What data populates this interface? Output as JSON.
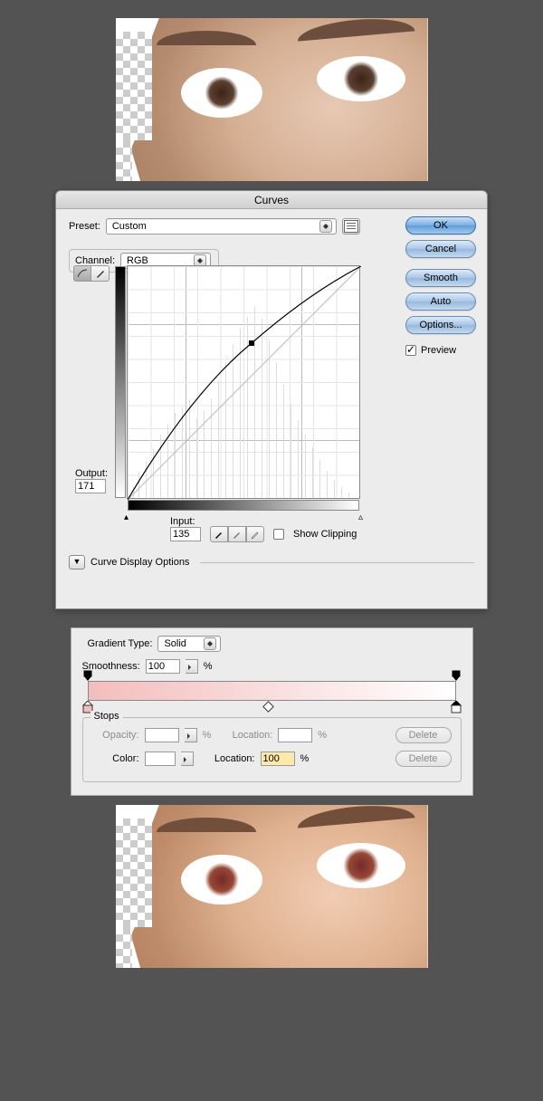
{
  "curves": {
    "title": "Curves",
    "preset_label": "Preset:",
    "preset_value": "Custom",
    "channel_label": "Channel:",
    "channel_value": "RGB",
    "output_label": "Output:",
    "output_value": "171",
    "input_label": "Input:",
    "input_value": "135",
    "show_clipping": "Show Clipping",
    "curve_display": "Curve Display Options",
    "buttons": {
      "ok": "OK",
      "cancel": "Cancel",
      "smooth": "Smooth",
      "auto": "Auto",
      "options": "Options..."
    },
    "preview": "Preview"
  },
  "chart_data": {
    "type": "line",
    "title": "Curves",
    "xlabel": "Input",
    "ylabel": "Output",
    "xlim": [
      0,
      255
    ],
    "ylim": [
      0,
      255
    ],
    "points": [
      {
        "input": 0,
        "output": 0
      },
      {
        "input": 135,
        "output": 171
      },
      {
        "input": 255,
        "output": 255
      }
    ],
    "baseline": [
      {
        "input": 0,
        "output": 0
      },
      {
        "input": 255,
        "output": 255
      }
    ]
  },
  "gradient": {
    "type_label": "Gradient Type:",
    "type_value": "Solid",
    "smoothness_label": "Smoothness:",
    "smoothness_value": "100",
    "pct": "%",
    "stops_legend": "Stops",
    "opacity_label": "Opacity:",
    "opacity_value": "",
    "opacity_location": "",
    "location_label": "Location:",
    "color_label": "Color:",
    "color_location": "100",
    "delete_label": "Delete",
    "colors": {
      "start": "#f4bdbd",
      "end": "#ffffff"
    }
  }
}
